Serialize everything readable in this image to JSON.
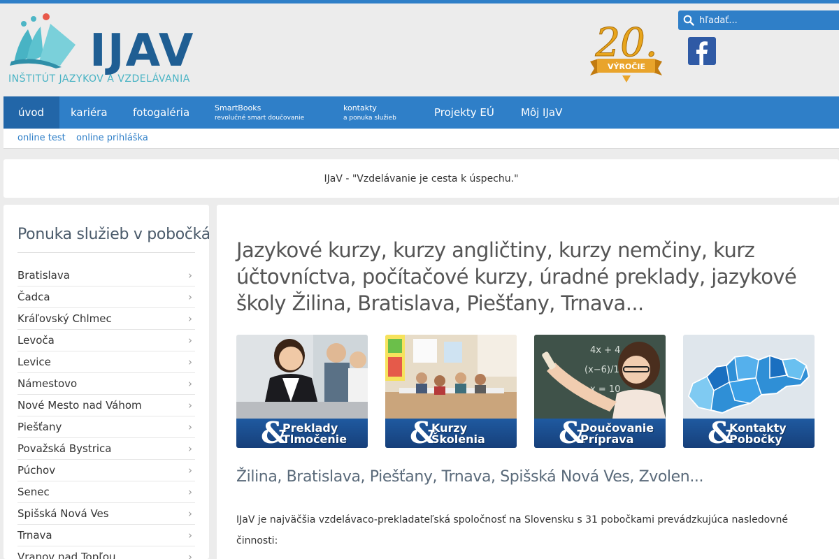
{
  "header": {
    "logo_text": "IJAV",
    "logo_subtitle": "INŠTITÚT JAZYKOV A VZDELÁVANIA",
    "anniversary_number": "20.",
    "anniversary_label": "VÝROČIE",
    "search_placeholder": "hľadať...",
    "colors": {
      "primary": "#2f7fc8",
      "logo_dark": "#1f5e93",
      "logo_teal": "#48b3c4",
      "facebook": "#2f5aa5"
    }
  },
  "nav": {
    "items": [
      {
        "label": "úvod"
      },
      {
        "label": "kariéra"
      },
      {
        "label": "fotogaléria"
      },
      {
        "label": "SmartBooks",
        "sub": "revolučné smart doučovanie"
      },
      {
        "label": "kontakty",
        "sub": "a ponuka služieb"
      },
      {
        "label": "Projekty EÚ"
      },
      {
        "label": "Môj IJaV"
      }
    ],
    "sub_items": [
      "online test",
      "online prihláška"
    ]
  },
  "motto": "IJaV  -  \"Vzdelávanie je cesta k úspechu.\"",
  "sidebar": {
    "title": "Ponuka služieb v pobočkách",
    "items": [
      "Bratislava",
      "Čadca",
      "Kráľovský Chlmec",
      "Levoča",
      "Levice",
      "Námestovo",
      "Nové Mesto nad Váhom",
      "Piešťany",
      "Považská Bystrica",
      "Púchov",
      "Senec",
      "Spišská Nová Ves",
      "Trnava",
      "Vranov nad Topľou"
    ]
  },
  "main": {
    "heading": "Jazykové kurzy, kurzy angličtiny, kurzy nemčiny, kurz účtovníctva, počítačové kurzy, úradné preklady, jazykové školy Žilina, Bratislava, Piešťany, Trnava...",
    "tiles": [
      {
        "amp": "&",
        "line1": "Preklady",
        "line2": "Tlmočenie"
      },
      {
        "amp": "&",
        "line1": "Kurzy",
        "line2": "Školenia"
      },
      {
        "amp": "&",
        "line1": "Doučovanie",
        "line2": "Príprava"
      },
      {
        "amp": "&",
        "line1": "Kontakty",
        "line2": "Pobočky"
      }
    ],
    "cities_heading": "Žilina, Bratislava, Piešťany, Trnava, Spišská Nová Ves, Zvolen...",
    "intro": "IJaV je najväčšia vzdelávaco-prekladateľská spoločnosť na Slovensku s 31 pobočkami prevádzkujúca nasledovné činnosti:"
  }
}
